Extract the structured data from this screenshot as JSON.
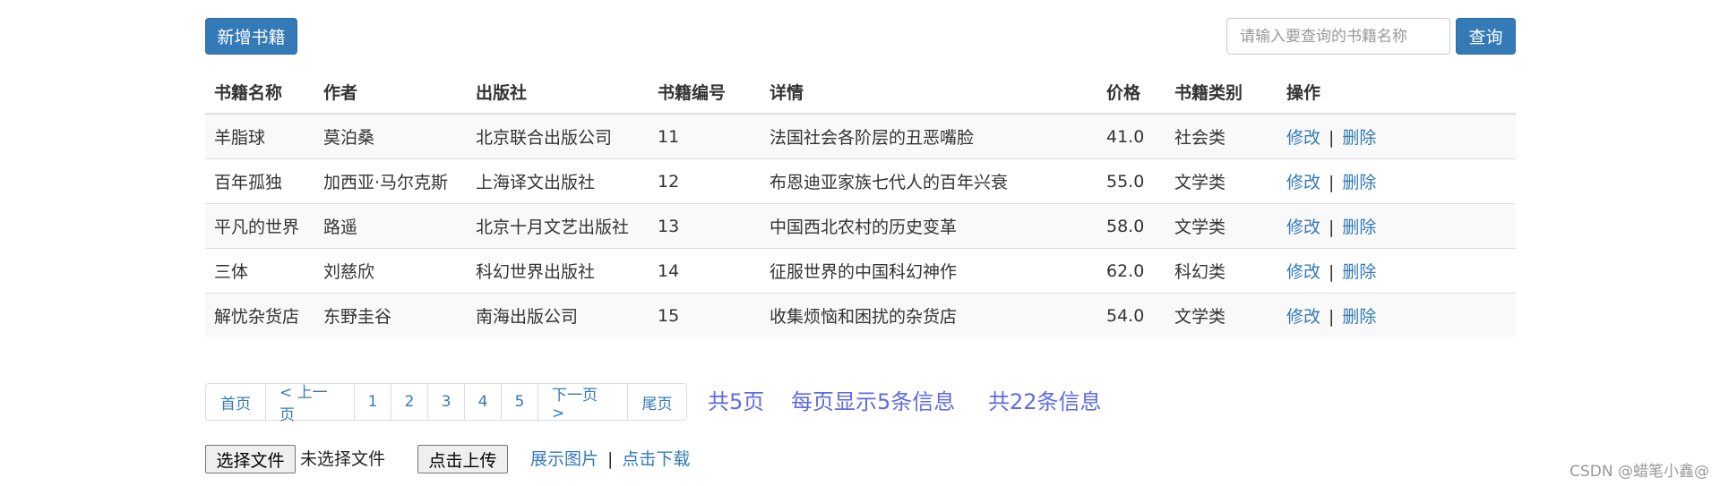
{
  "toolbar": {
    "add_label": "新增书籍",
    "search_placeholder": "请输入要查询的书籍名称",
    "search_label": "查询"
  },
  "table": {
    "headers": [
      "书籍名称",
      "作者",
      "出版社",
      "书籍编号",
      "详情",
      "价格",
      "书籍类别",
      "操作"
    ],
    "rows": [
      {
        "name": "羊脂球",
        "author": "莫泊桑",
        "publisher": "北京联合出版公司",
        "id": "11",
        "detail": "法国社会各阶层的丑恶嘴脸",
        "price": "41.0",
        "category": "社会类"
      },
      {
        "name": "百年孤独",
        "author": "加西亚·马尔克斯",
        "publisher": "上海译文出版社",
        "id": "12",
        "detail": "布恩迪亚家族七代人的百年兴衰",
        "price": "55.0",
        "category": "文学类"
      },
      {
        "name": "平凡的世界",
        "author": "路遥",
        "publisher": "北京十月文艺出版社",
        "id": "13",
        "detail": "中国西北农村的历史变革",
        "price": "58.0",
        "category": "文学类"
      },
      {
        "name": "三体",
        "author": "刘慈欣",
        "publisher": "科幻世界出版社",
        "id": "14",
        "detail": "征服世界的中国科幻神作",
        "price": "62.0",
        "category": "科幻类"
      },
      {
        "name": "解忧杂货店",
        "author": "东野圭谷",
        "publisher": "南海出版公司",
        "id": "15",
        "detail": "收集烦恼和困扰的杂货店",
        "price": "54.0",
        "category": "文学类"
      }
    ],
    "edit_label": "修改",
    "op_separator": "|",
    "delete_label": "删除"
  },
  "pagination": {
    "first": "首页",
    "prev": "< 上一页",
    "pages": [
      "1",
      "2",
      "3",
      "4",
      "5"
    ],
    "next": "下一页 >",
    "last": "尾页",
    "total_pages": "共5页",
    "per_page": "每页显示5条信息",
    "total_items": "共22条信息"
  },
  "upload": {
    "choose_label": "选择文件",
    "no_file_text": "未选择文件",
    "upload_label": "点击上传",
    "show_image": "展示图片",
    "separator": "|",
    "download": "点击下载"
  },
  "watermark": "CSDN @蜡笔小鑫@",
  "colors": {
    "primary": "#337ab7",
    "info_text": "#5f6be0",
    "stripe": "#f9f9f9"
  }
}
